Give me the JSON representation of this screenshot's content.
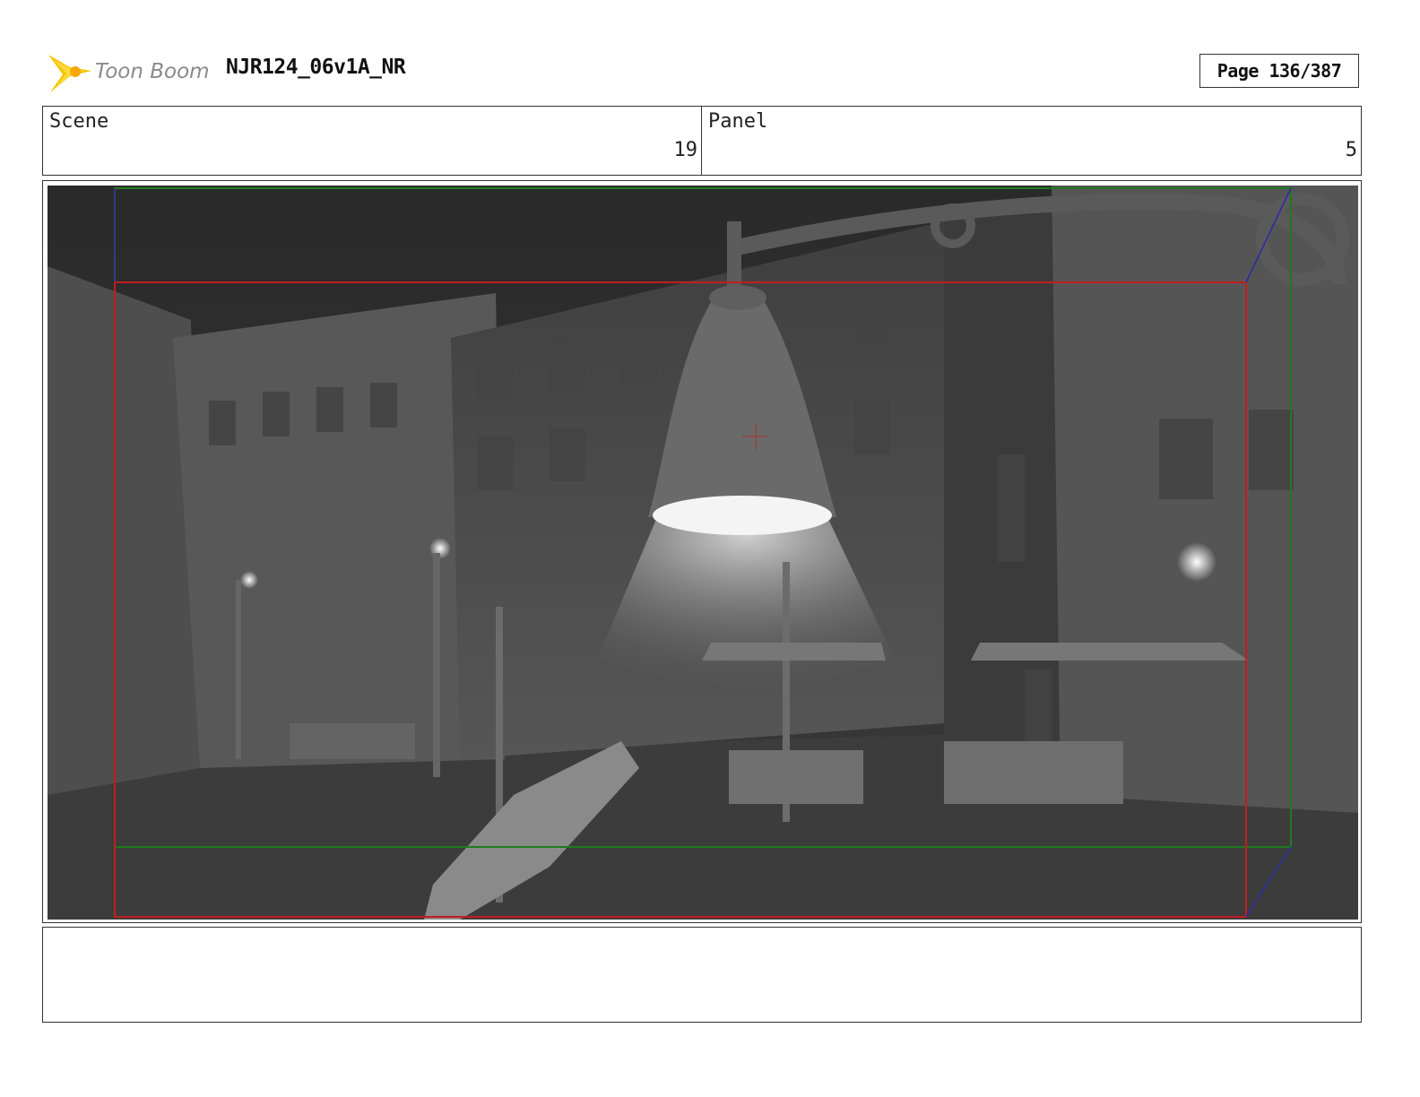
{
  "header": {
    "logo_text": "Toon Boom",
    "logo_icon": "toon-boom-star-icon",
    "title": "NJR124_06v1A_NR",
    "page": "Page 136/387"
  },
  "info": {
    "scene_label": "Scene",
    "scene_value": "19",
    "panel_label": "Panel",
    "panel_value": "5"
  },
  "panel_image": {
    "description_icon": "street-lamp-scene-image",
    "guides": {
      "safe_frame_color": "#c41d1d",
      "camera_frame_color": "#1f7a1f",
      "corner_lines_color": "#2a2aa8"
    }
  },
  "notes": {
    "text": ""
  },
  "colors": {
    "logo_yellow": "#f5c400",
    "logo_gray": "#8a8a8a"
  }
}
